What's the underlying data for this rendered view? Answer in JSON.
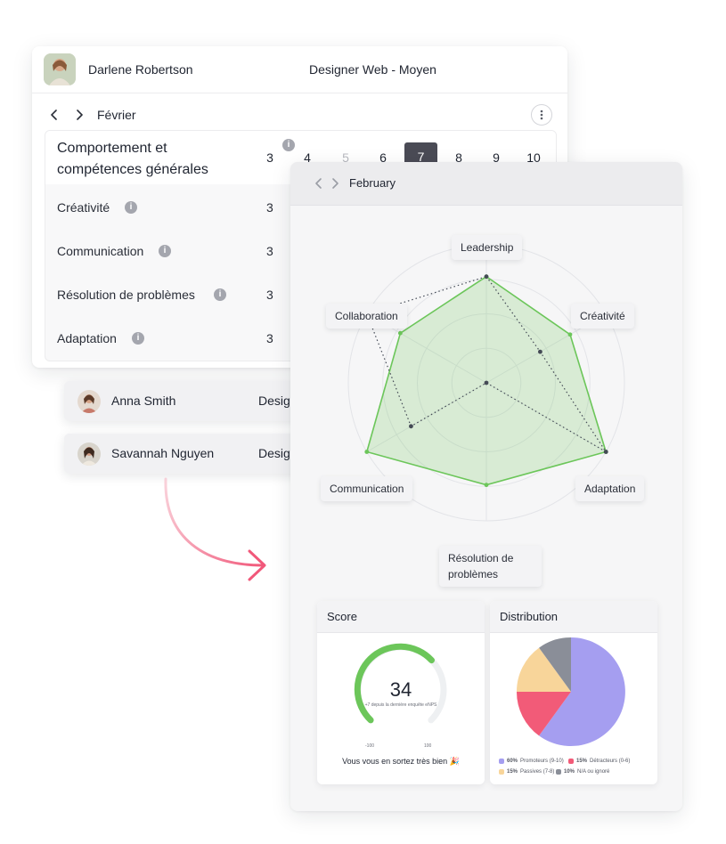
{
  "back_panel": {
    "person_name": "Darlene Robertson",
    "person_role": "Designer Web - Moyen",
    "month": "Février",
    "section_title": "Comportement et compétences générales",
    "scale": [
      "3",
      "4",
      "5",
      "6",
      "7",
      "8",
      "9",
      "10"
    ],
    "selected_scale": "7",
    "criteria": [
      {
        "label": "Créativité",
        "value": "3"
      },
      {
        "label": "Communication",
        "value": "3"
      },
      {
        "label": "Résolution de problèmes",
        "value": "3"
      },
      {
        "label": "Adaptation",
        "value": "3"
      }
    ]
  },
  "list": [
    {
      "name": "Anna Smith",
      "role": "Design"
    },
    {
      "name": "Savannah Nguyen",
      "role": "Design"
    }
  ],
  "front_panel": {
    "month": "February",
    "radar": {
      "axes": [
        "Leadership",
        "Créativité",
        "Adaptation",
        "Résolution de problèmes",
        "Communication",
        "Collaboration"
      ],
      "series": [
        {
          "values": [
            0.77,
            0.7,
            1.0,
            0.74,
            1.0,
            0.72
          ],
          "color": "#6cc65a",
          "style": "filled"
        },
        {
          "values": [
            0.77,
            0.45,
            1.0,
            0.0,
            0.63,
            1.0
          ],
          "color": "#444a55",
          "style": "dotted"
        }
      ]
    },
    "score": {
      "title": "Score",
      "value": "34",
      "fraction": 0.67,
      "subtitle": "+7 depuis la dernière enquête eNPS",
      "min_label": "-100",
      "max_label": "100",
      "message": "Vous vous en sortez très bien 🎉",
      "color": "#6cc65a"
    },
    "distribution": {
      "title": "Distribution",
      "slices": [
        {
          "pct": "60%",
          "label": "Promoteurs (9-10)",
          "value": 60,
          "color": "#a59ef0"
        },
        {
          "pct": "15%",
          "label": "Détracteurs (0-6)",
          "value": 15,
          "color": "#f25b78"
        },
        {
          "pct": "15%",
          "label": "Passives (7-8)",
          "value": 15,
          "color": "#f8d59a"
        },
        {
          "pct": "10%",
          "label": "N/A ou ignoré",
          "value": 10,
          "color": "#8a8e98"
        }
      ]
    }
  },
  "colors": {
    "accent": "#6cc65a",
    "arrow": "#f1587a",
    "selected": "#4a4b55"
  },
  "icons": [
    "chevron-left-icon",
    "chevron-right-icon",
    "more-vertical-icon",
    "info-icon",
    "curved-arrow-icon"
  ]
}
